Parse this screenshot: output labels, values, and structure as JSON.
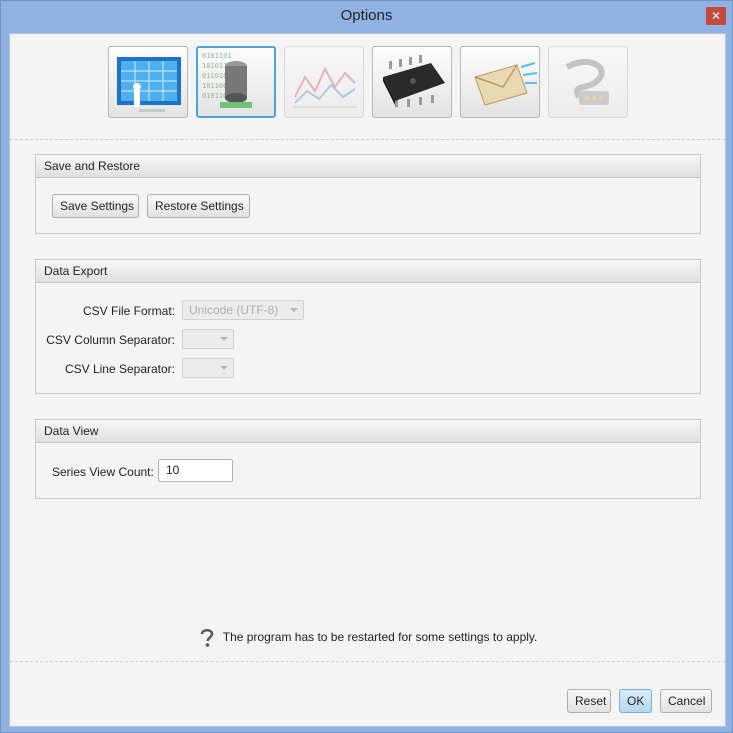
{
  "window": {
    "title": "Options",
    "close_glyph": "✕"
  },
  "toolbar": {
    "items": [
      {
        "name": "display-settings-icon",
        "selected": false,
        "disabled": false
      },
      {
        "name": "database-settings-icon",
        "selected": true,
        "disabled": false
      },
      {
        "name": "chart-settings-icon",
        "selected": false,
        "disabled": true
      },
      {
        "name": "chip-settings-icon",
        "selected": false,
        "disabled": false
      },
      {
        "name": "email-settings-icon",
        "selected": false,
        "disabled": false
      },
      {
        "name": "cable-settings-icon",
        "selected": false,
        "disabled": true
      }
    ]
  },
  "save_restore": {
    "header": "Save and Restore",
    "save_label": "Save Settings",
    "restore_label": "Restore Settings"
  },
  "data_export": {
    "header": "Data Export",
    "csv_format_label": "CSV File Format:",
    "csv_format_value": "Unicode (UTF-8)",
    "csv_column_label": "CSV Column Separator:",
    "csv_column_value": "",
    "csv_line_label": "CSV Line Separator:",
    "csv_line_value": ""
  },
  "data_view": {
    "header": "Data View",
    "series_count_label": "Series View Count:",
    "series_count_value": "10"
  },
  "notice": {
    "text": "The program has to be restarted for some settings to apply."
  },
  "footer": {
    "reset_label": "Reset",
    "ok_label": "OK",
    "cancel_label": "Cancel"
  },
  "colors": {
    "frame": "#8fb2e3",
    "client": "#f4f4f4",
    "selection": "#4ea6d8",
    "close": "#c7483c"
  }
}
